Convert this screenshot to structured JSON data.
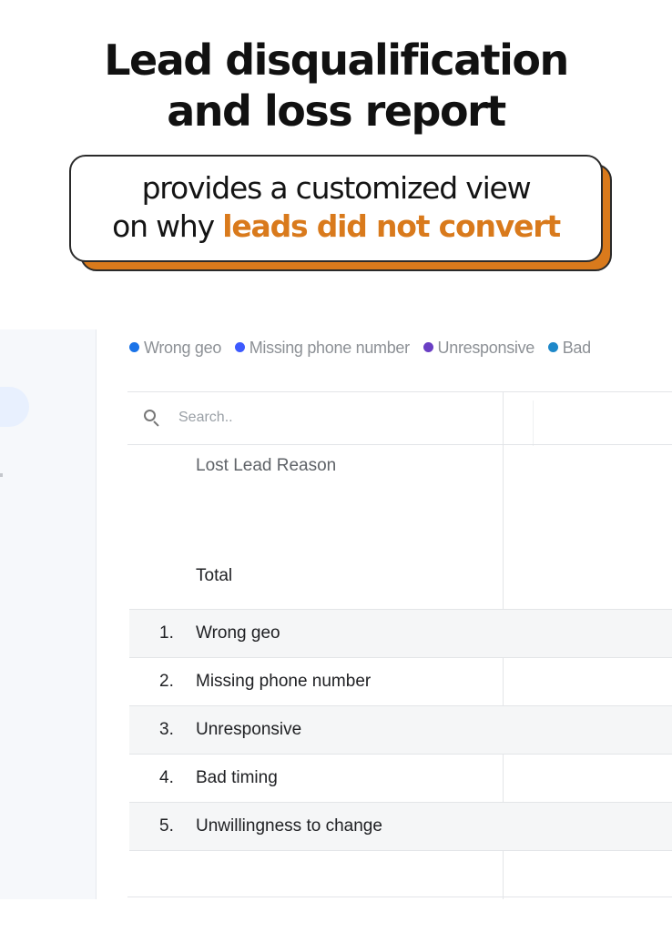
{
  "headline": {
    "line1": "Lead disqualification",
    "line2": "and loss report"
  },
  "callout": {
    "line1": "provides a customized view",
    "line2_prefix": "on why ",
    "line2_highlight": "leads did not convert",
    "highlight_color": "#d97a1c"
  },
  "legend": [
    {
      "label": "Wrong geo",
      "color": "#1a73e8"
    },
    {
      "label": "Missing phone number",
      "color": "#3d5afe"
    },
    {
      "label": "Unresponsive",
      "color": "#6a3fc4"
    },
    {
      "label": "Bad",
      "color": "#1e88c9"
    }
  ],
  "search": {
    "placeholder": "Search..",
    "icon": "search-icon"
  },
  "table": {
    "column_header": "Lost Lead Reason",
    "total_label": "Total",
    "rows": [
      {
        "num": "1.",
        "label": "Wrong geo"
      },
      {
        "num": "2.",
        "label": "Missing phone number"
      },
      {
        "num": "3.",
        "label": "Unresponsive"
      },
      {
        "num": "4.",
        "label": "Bad timing"
      },
      {
        "num": "5.",
        "label": "Unwillingness to change"
      }
    ]
  }
}
